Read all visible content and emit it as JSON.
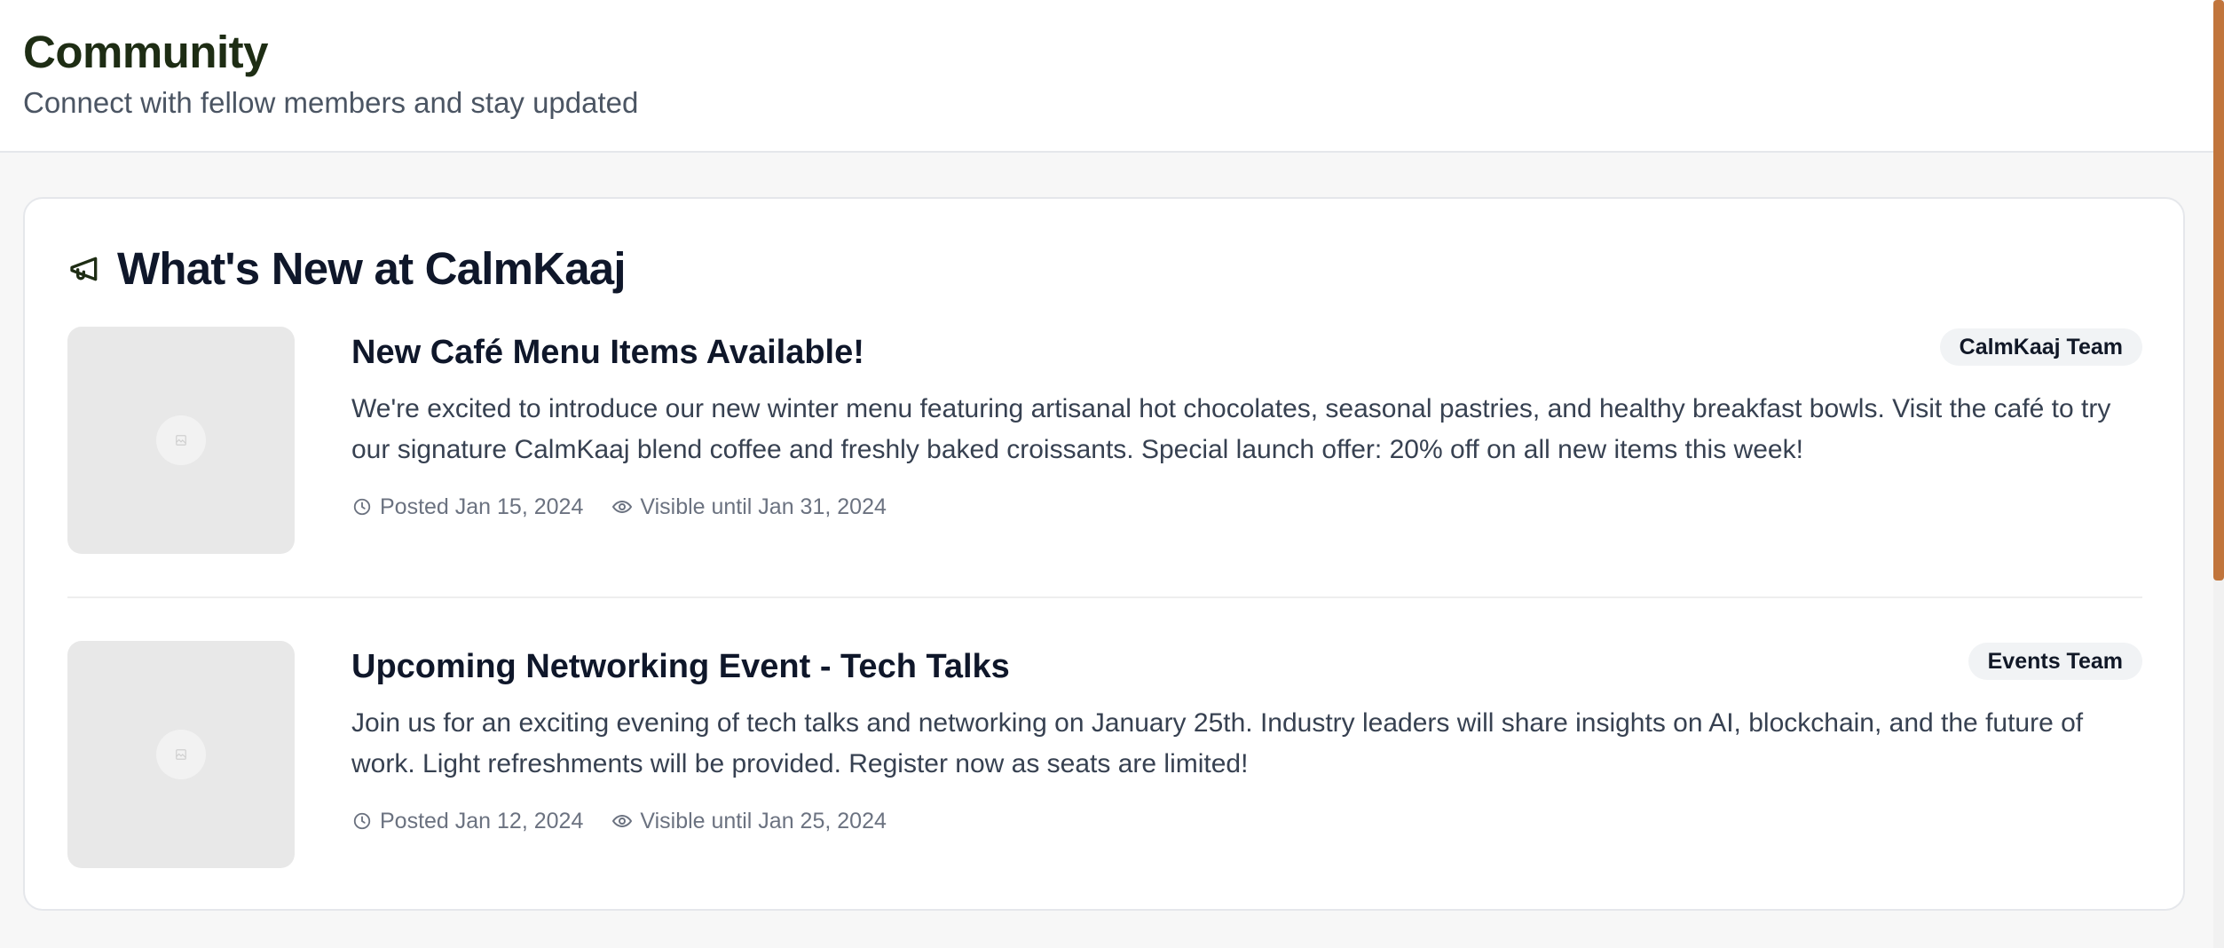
{
  "header": {
    "title": "Community",
    "subtitle": "Connect with fellow members and stay updated"
  },
  "news": {
    "title": "What's New at CalmKaaj",
    "items": [
      {
        "title": "New Café Menu Items Available!",
        "badge": "CalmKaaj Team",
        "body": "We're excited to introduce our new winter menu featuring artisanal hot chocolates, seasonal pastries, and healthy breakfast bowls. Visit the café to try our signature CalmKaaj blend coffee and freshly baked croissants. Special launch offer: 20% off on all new items this week!",
        "posted": "Posted Jan 15, 2024",
        "visible": "Visible until Jan 31, 2024"
      },
      {
        "title": "Upcoming Networking Event - Tech Talks",
        "badge": "Events Team",
        "body": "Join us for an exciting evening of tech talks and networking on January 25th. Industry leaders will share insights on AI, blockchain, and the future of work. Light refreshments will be provided. Register now as seats are limited!",
        "posted": "Posted Jan 12, 2024",
        "visible": "Visible until Jan 25, 2024"
      }
    ]
  },
  "icons": {
    "section": "megaphone-icon",
    "posted": "clock-icon",
    "visible": "eye-icon",
    "thumbnail": "image-placeholder-icon"
  },
  "colors": {
    "title": "#1e2d14",
    "scrollbar_accent": "#c1753c",
    "badge_bg": "#f1f3f5",
    "thumbnail_bg": "#e8e8e8"
  }
}
